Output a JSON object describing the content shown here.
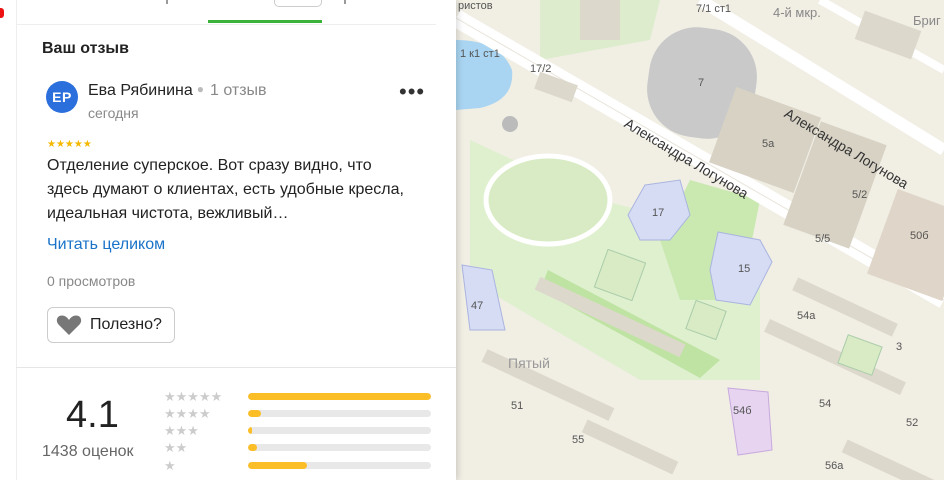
{
  "panel": {
    "section_title": "Ваш отзыв",
    "review": {
      "avatar_initials": "ЕР",
      "author": "Ева Рябинина",
      "author_reviews": "1 отзыв",
      "date": "сегодня",
      "rating": 5,
      "stars": "★★★★★",
      "text": "Отделение суперское. Вот сразу видно, что здесь думают о клиентах, есть удобные кресла, идеальная чистота, вежливый…",
      "read_more": "Читать целиком",
      "views": "0 просмотров",
      "useful_label": "Полезно?",
      "more_label": "•••"
    },
    "summary": {
      "rating": "4.1",
      "count": "1438 оценок",
      "distribution": [
        {
          "stars": "★★★★★",
          "fraction": 1.0
        },
        {
          "stars": "★★★★",
          "fraction": 0.07
        },
        {
          "stars": "★★★",
          "fraction": 0.02
        },
        {
          "stars": "★★",
          "fraction": 0.05
        },
        {
          "stars": "★",
          "fraction": 0.32
        }
      ]
    }
  },
  "map": {
    "streets": [
      "Александра Логунова",
      "Александра Логунова"
    ],
    "labels": [
      "7/1 ст1",
      "4-й мкр.",
      "Бриг",
      "1 к1 ст1",
      "17/2",
      "7",
      "5а",
      "17",
      "5/2",
      "50б",
      "5/5",
      "15",
      "47",
      "54а",
      "3",
      "Пятый",
      "51",
      "54б",
      "54",
      "52",
      "55",
      "56а",
      "ристов"
    ]
  },
  "colors": {
    "accent_green": "#3bb33b",
    "link": "#1a73c8",
    "star": "#f5b800",
    "bar": "#fbbe26",
    "avatar": "#2b6fdc"
  }
}
